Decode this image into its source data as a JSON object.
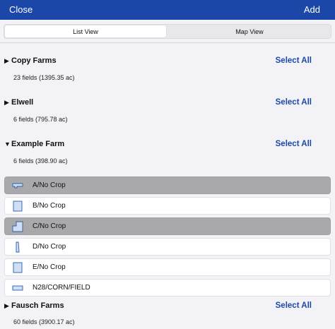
{
  "nav": {
    "close_label": "Close",
    "add_label": "Add"
  },
  "view_toggle": {
    "list_label": "List View",
    "map_label": "Map View",
    "selected": "List View"
  },
  "farms": [
    {
      "name": "Copy Farms",
      "expanded": false,
      "summary": "23 fields (1395.35 ac)",
      "select_all_label": "Select All"
    },
    {
      "name": "Elwell",
      "expanded": false,
      "summary": "6 fields (795.78 ac)",
      "select_all_label": "Select All"
    },
    {
      "name": "Example Farm",
      "expanded": true,
      "summary": "6 fields (398.90 ac)",
      "select_all_label": "Select All",
      "fields": [
        {
          "label": "A/No Crop",
          "selected": true,
          "icon": "field-boundary-l-shape-icon"
        },
        {
          "label": "B/No Crop",
          "selected": false,
          "icon": "field-boundary-square-icon"
        },
        {
          "label": "C/No Crop",
          "selected": true,
          "icon": "field-boundary-stepped-icon"
        },
        {
          "label": "D/No Crop",
          "selected": false,
          "icon": "field-boundary-narrow-icon"
        },
        {
          "label": "E/No Crop",
          "selected": false,
          "icon": "field-boundary-square-icon"
        },
        {
          "label": "N28/CORN/FIELD",
          "selected": false,
          "icon": "field-boundary-rectangle-icon"
        }
      ]
    },
    {
      "name": "Fausch Farms",
      "expanded": false,
      "summary": "60 fields (3900.17 ac)",
      "select_all_label": "Select All"
    }
  ],
  "colors": {
    "nav_bar": "#1b48a8",
    "accent": "#1b48a8",
    "selected_row": "#a9a9ab",
    "field_fill": "#cfe0f5",
    "field_stroke": "#2a5ea8"
  }
}
